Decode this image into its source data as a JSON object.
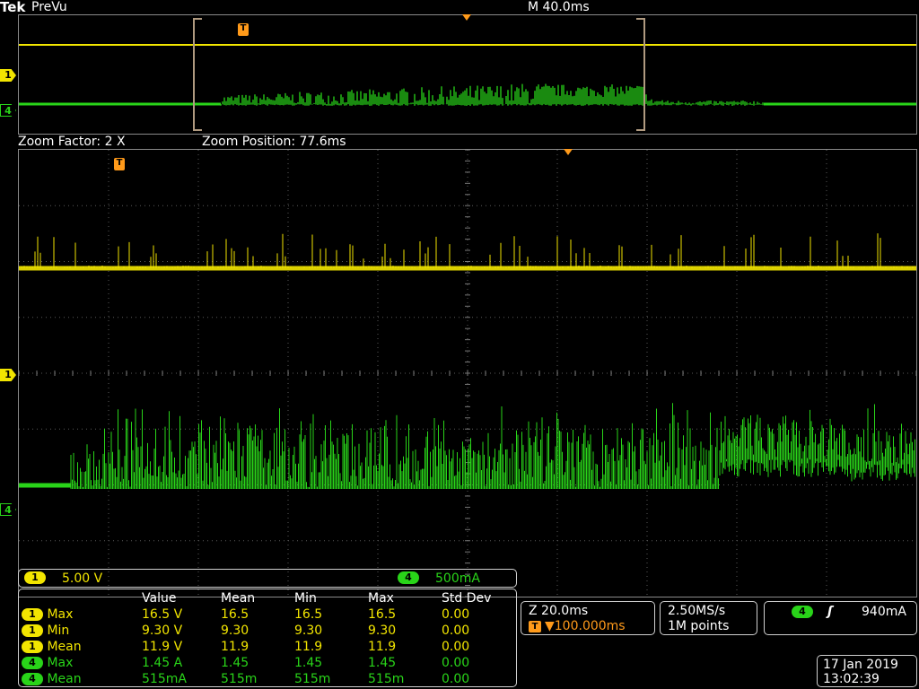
{
  "header": {
    "brand": "Tek",
    "mode": "PreVu",
    "timebase": "M 40.0ms"
  },
  "zoom_bar": {
    "factor": "Zoom Factor: 2 X",
    "position": "Zoom Position: 77.6ms"
  },
  "markers": {
    "ch1": "1",
    "ch4": "4",
    "trigger": "T"
  },
  "channel_readout": {
    "ch1_num": "1",
    "ch1_scale": "5.00 V",
    "ch4_num": "4",
    "ch4_scale": "500mA"
  },
  "measurements": {
    "headers": [
      "Value",
      "Mean",
      "Min",
      "Max",
      "Std Dev"
    ],
    "rows": [
      {
        "ch": "1",
        "name": "Max",
        "value": "16.5 V",
        "mean": "16.5",
        "min": "16.5",
        "max": "16.5",
        "std": "0.00"
      },
      {
        "ch": "1",
        "name": "Min",
        "value": "9.30 V",
        "mean": "9.30",
        "min": "9.30",
        "max": "9.30",
        "std": "0.00"
      },
      {
        "ch": "1",
        "name": "Mean",
        "value": "11.9 V",
        "mean": "11.9",
        "min": "11.9",
        "max": "11.9",
        "std": "0.00"
      },
      {
        "ch": "4",
        "name": "Max",
        "value": "1.45 A",
        "mean": "1.45",
        "min": "1.45",
        "max": "1.45",
        "std": "0.00"
      },
      {
        "ch": "4",
        "name": "Mean",
        "value": "515mA",
        "mean": "515m",
        "min": "515m",
        "max": "515m",
        "std": "0.00"
      }
    ]
  },
  "zoom_info": {
    "scale": "Z 20.0ms",
    "trigger_pos": "▼100.000ms"
  },
  "acquisition": {
    "rate": "2.50MS/s",
    "points": "1M points"
  },
  "trigger": {
    "source": "4",
    "slope": "ʃ",
    "level": "940mA"
  },
  "datetime": {
    "date": "17 Jan  2019",
    "time": "13:02:39"
  },
  "colors": {
    "ch1": "#f2e500",
    "ch4": "#29d419",
    "trigger": "#ff9a1a",
    "grid": "#8a8a8a"
  }
}
